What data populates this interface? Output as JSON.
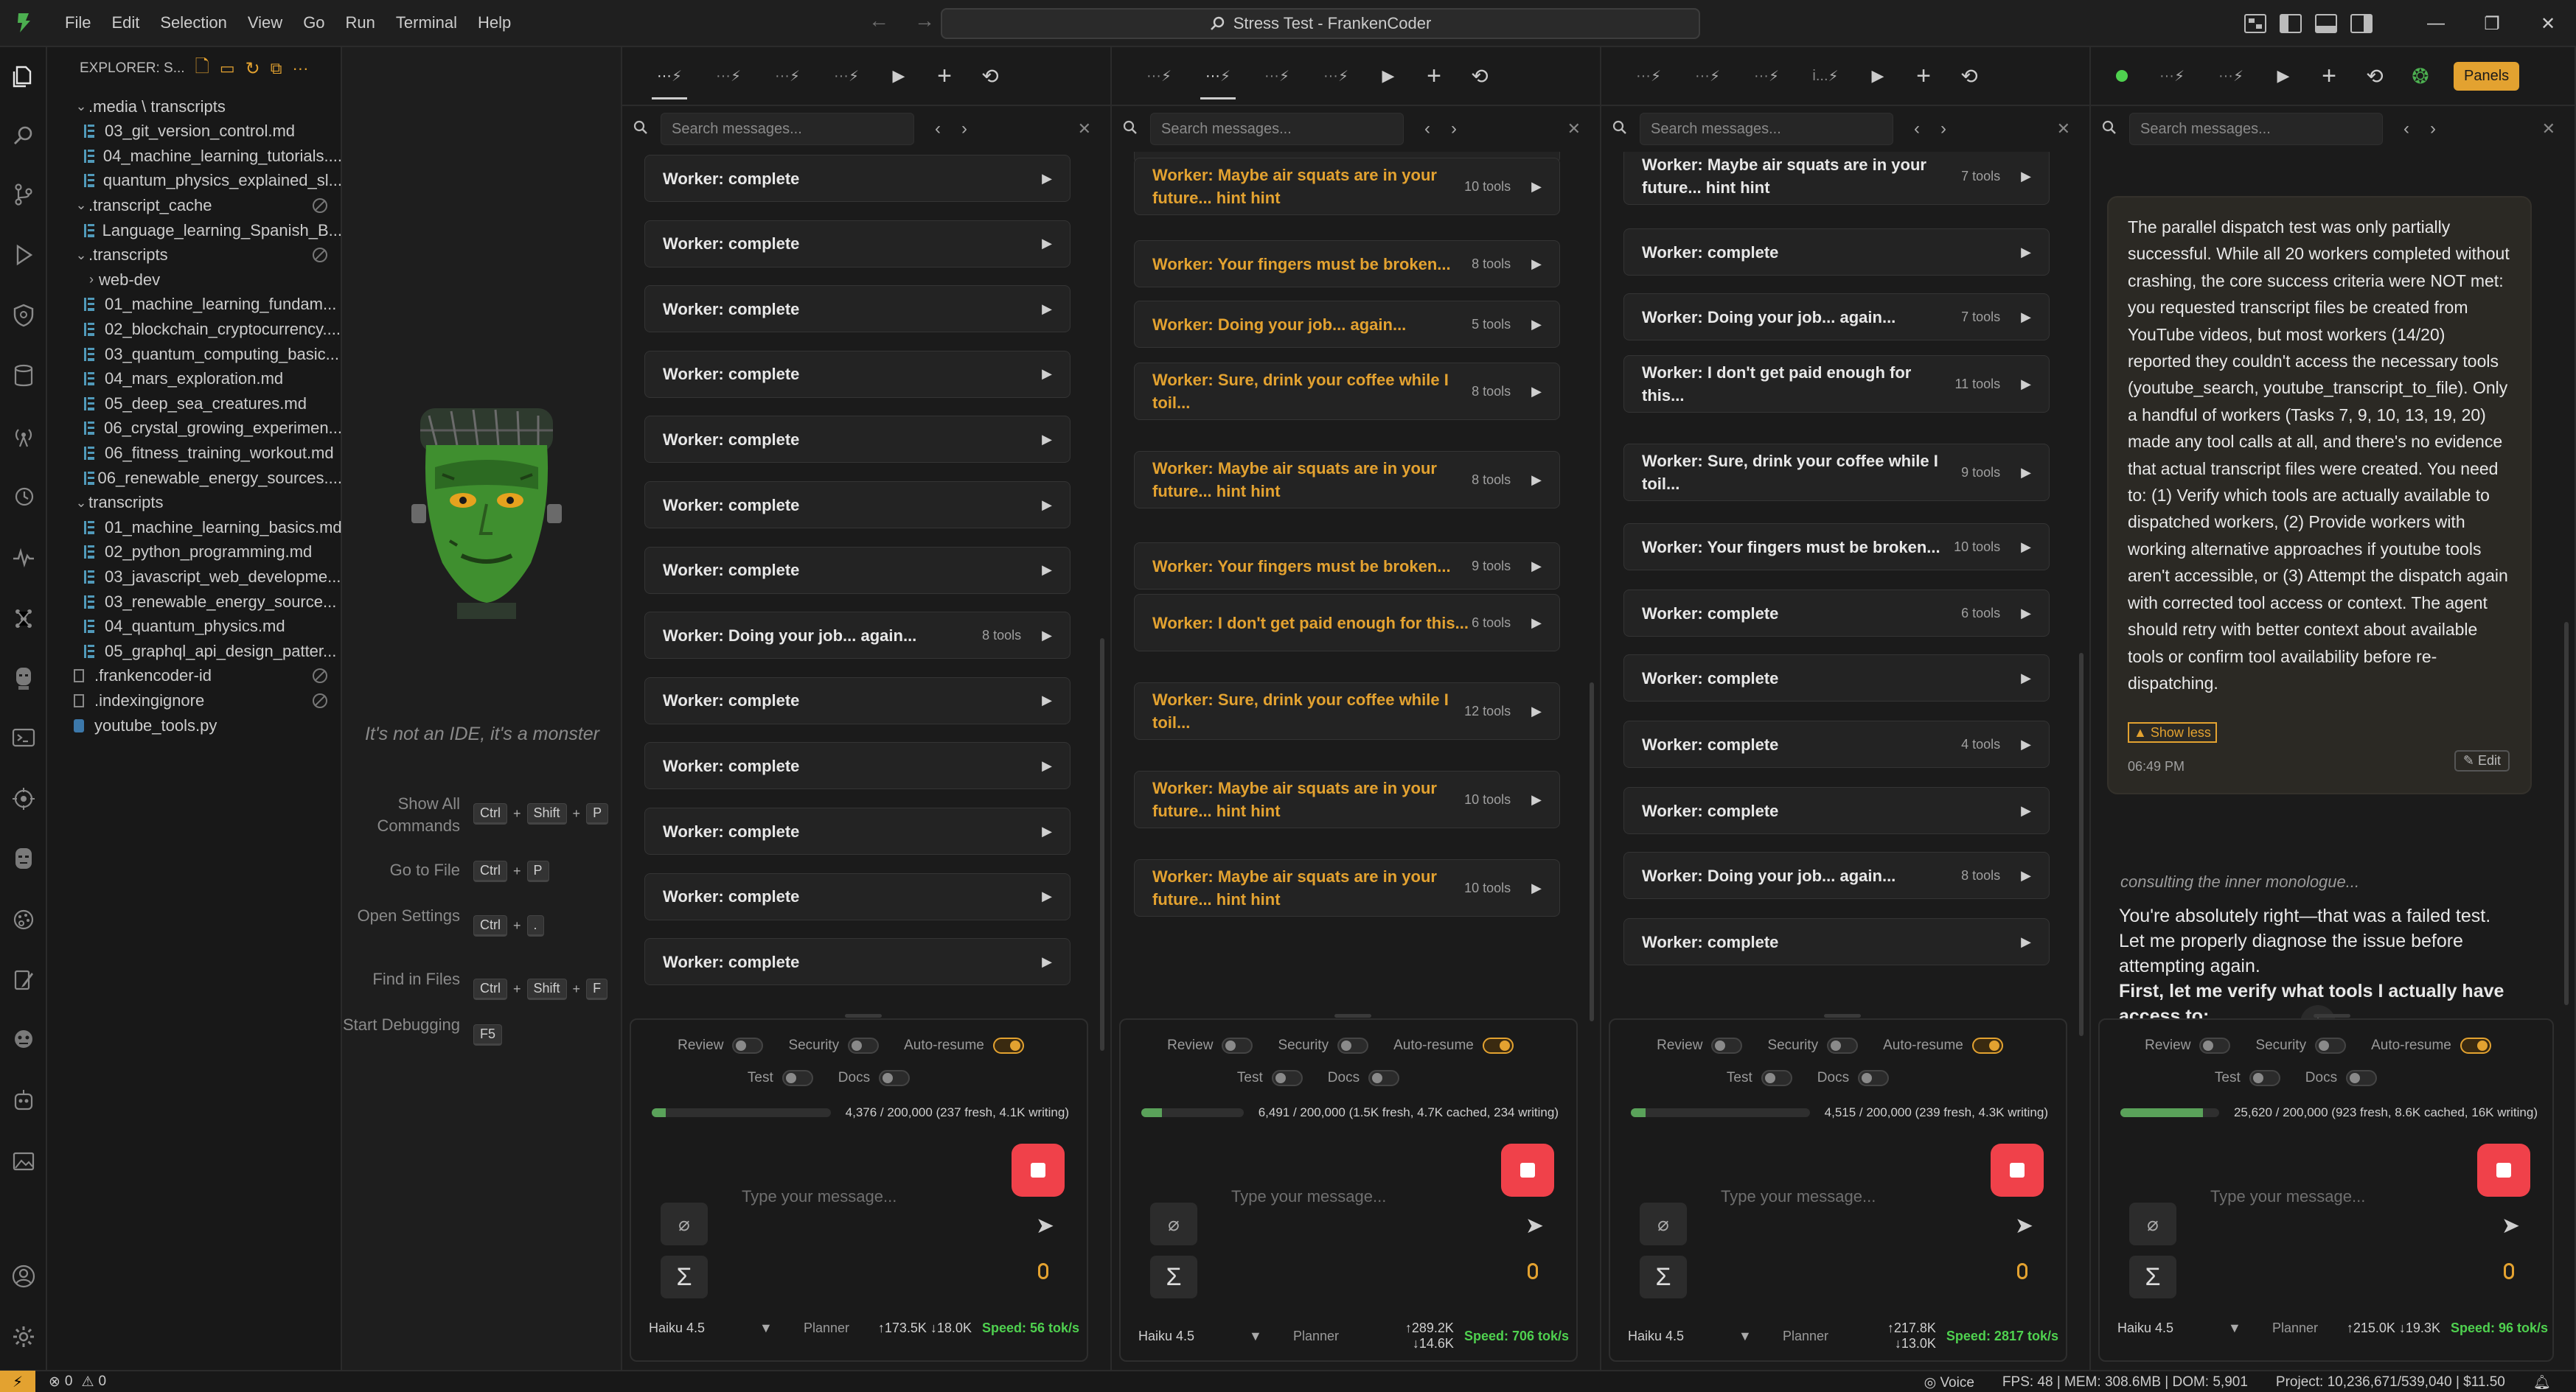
{
  "app": {
    "title": "Stress Test - FrankenCoder"
  },
  "menu": [
    "File",
    "Edit",
    "Selection",
    "View",
    "Go",
    "Run",
    "Terminal",
    "Help"
  ],
  "titlebar": {
    "panels_label": "Panels",
    "nav_back": "←",
    "nav_forward": "→"
  },
  "explorer": {
    "header": "EXPLORER: S...",
    "items": [
      {
        "label": ".media \\ transcripts",
        "type": "folder",
        "open": true,
        "depth": 0
      },
      {
        "label": "03_git_version_control.md",
        "type": "md",
        "depth": 1
      },
      {
        "label": "04_machine_learning_tutorials....",
        "type": "md",
        "depth": 1
      },
      {
        "label": "quantum_physics_explained_sl...",
        "type": "md",
        "depth": 1
      },
      {
        "label": ".transcript_cache",
        "type": "folder",
        "open": true,
        "depth": 0,
        "blocked": true
      },
      {
        "label": "Language_learning_Spanish_B...",
        "type": "md",
        "depth": 1
      },
      {
        "label": ".transcripts",
        "type": "folder",
        "open": true,
        "depth": 0,
        "blocked": true
      },
      {
        "label": "web-dev",
        "type": "folder",
        "open": false,
        "depth": 1
      },
      {
        "label": "01_machine_learning_fundam...",
        "type": "md",
        "depth": 1
      },
      {
        "label": "02_blockchain_cryptocurrency....",
        "type": "md",
        "depth": 1
      },
      {
        "label": "03_quantum_computing_basic...",
        "type": "md",
        "depth": 1
      },
      {
        "label": "04_mars_exploration.md",
        "type": "md",
        "depth": 1
      },
      {
        "label": "05_deep_sea_creatures.md",
        "type": "md",
        "depth": 1
      },
      {
        "label": "06_crystal_growing_experimen...",
        "type": "md",
        "depth": 1
      },
      {
        "label": "06_fitness_training_workout.md",
        "type": "md",
        "depth": 1
      },
      {
        "label": "06_renewable_energy_sources....",
        "type": "md",
        "depth": 1
      },
      {
        "label": "transcripts",
        "type": "folder",
        "open": true,
        "depth": 0
      },
      {
        "label": "01_machine_learning_basics.md",
        "type": "md",
        "depth": 1
      },
      {
        "label": "02_python_programming.md",
        "type": "md",
        "depth": 1
      },
      {
        "label": "03_javascript_web_developme...",
        "type": "md",
        "depth": 1
      },
      {
        "label": "03_renewable_energy_source...",
        "type": "md",
        "depth": 1
      },
      {
        "label": "04_quantum_physics.md",
        "type": "md",
        "depth": 1
      },
      {
        "label": "05_graphql_api_design_patter...",
        "type": "md",
        "depth": 1
      },
      {
        "label": ".frankencoder-id",
        "type": "cfg",
        "depth": 0,
        "blocked": true
      },
      {
        "label": ".indexingignore",
        "type": "cfg",
        "depth": 0,
        "blocked": true
      },
      {
        "label": "youtube_tools.py",
        "type": "py",
        "depth": 0
      }
    ]
  },
  "welcome": {
    "tagline": "It's not an IDE, it's a monster",
    "shortcuts": [
      {
        "label": "Show All Commands",
        "keys": [
          "Ctrl",
          "Shift",
          "P"
        ]
      },
      {
        "label": "Go to File",
        "keys": [
          "Ctrl",
          "P"
        ]
      },
      {
        "label": "Open Settings",
        "keys": [
          "Ctrl",
          "."
        ]
      },
      {
        "label": "Find in Files",
        "keys": [
          "Ctrl",
          "Shift",
          "F"
        ]
      },
      {
        "label": "Start Debugging",
        "keys": [
          "F5"
        ]
      }
    ]
  },
  "common": {
    "search_placeholder": "Search messages...",
    "message_placeholder": "Type your message...",
    "toggles": {
      "review": "Review",
      "security": "Security",
      "auto_resume": "Auto-resume",
      "test": "Test",
      "docs": "Docs"
    },
    "model": "Haiku 4.5",
    "mode": "Planner",
    "edit_label": "Edit",
    "show_less": "▲ Show less"
  },
  "panels": [
    {
      "tabs": [
        "···",
        "···",
        "···",
        "···"
      ],
      "active_tab": 0,
      "workers": [
        {
          "title": "Worker: complete",
          "tools": ""
        },
        {
          "title": "Worker: complete",
          "tools": ""
        },
        {
          "title": "Worker: complete",
          "tools": ""
        },
        {
          "title": "Worker: complete",
          "tools": ""
        },
        {
          "title": "Worker: complete",
          "tools": ""
        },
        {
          "title": "Worker: complete",
          "tools": ""
        },
        {
          "title": "Worker: complete",
          "tools": ""
        },
        {
          "title": "Worker: Doing your job... again...",
          "tools": "8 tools"
        },
        {
          "title": "Worker: complete",
          "tools": ""
        },
        {
          "title": "Worker: complete",
          "tools": ""
        },
        {
          "title": "Worker: complete",
          "tools": ""
        },
        {
          "title": "Worker: complete",
          "tools": ""
        },
        {
          "title": "Worker: complete",
          "tools": ""
        }
      ],
      "progress": {
        "fraction": 0.02188,
        "text": "4,376 / 200,000 (237 fresh, 4.1K writing)"
      },
      "stats": "↑173.5K ↓18.0K",
      "speed": "Speed: 56 tok/s",
      "auto_resume": true
    },
    {
      "tabs": [
        "···",
        "···",
        "···",
        "···"
      ],
      "active_tab": 1,
      "workers": [
        {
          "title": "Worker: Maybe air squats are in your future... hint hint",
          "tools": "10 tools",
          "warn": true
        },
        {
          "title": "Worker: Your fingers must be broken...",
          "tools": "8 tools",
          "warn": true
        },
        {
          "title": "Worker: Doing your job... again...",
          "tools": "5 tools",
          "warn": true
        },
        {
          "title": "Worker: Sure, drink your coffee while I toil...",
          "tools": "8 tools",
          "warn": true
        },
        {
          "title": "Worker: Maybe air squats are in your future... hint hint",
          "tools": "8 tools",
          "warn": true
        },
        {
          "title": "Worker: Your fingers must be broken...",
          "tools": "9 tools",
          "warn": true
        },
        {
          "title": "Worker: I don't get paid enough for this...",
          "tools": "6 tools",
          "warn": true
        },
        {
          "title": "Worker: Sure, drink your coffee while I toil...",
          "tools": "12 tools",
          "warn": true
        },
        {
          "title": "Worker: Maybe air squats are in your future... hint hint",
          "tools": "10 tools",
          "warn": true
        },
        {
          "title": "Worker: Maybe air squats are in your future... hint hint",
          "tools": "10 tools",
          "warn": true
        }
      ],
      "progress": {
        "fraction": 0.03246,
        "text": "6,491 / 200,000 (1.5K fresh, 4.7K cached, 234 writing)"
      },
      "stats": "↑289.2K ↓14.6K",
      "speed": "Speed: 706 tok/s",
      "auto_resume": true
    },
    {
      "tabs": [
        "···",
        "···",
        "···",
        "i..."
      ],
      "active_tab": -1,
      "workers": [
        {
          "title": "Worker: Maybe air squats are in your future... hint hint",
          "tools": "7 tools"
        },
        {
          "title": "Worker: complete",
          "tools": ""
        },
        {
          "title": "Worker: Doing your job... again...",
          "tools": "7 tools"
        },
        {
          "title": "Worker: I don't get paid enough for this...",
          "tools": "11 tools"
        },
        {
          "title": "Worker: Sure, drink your coffee while I toil...",
          "tools": "9 tools"
        },
        {
          "title": "Worker: Your fingers must be broken...",
          "tools": "10 tools"
        },
        {
          "title": "Worker: complete",
          "tools": "6 tools"
        },
        {
          "title": "Worker: complete",
          "tools": ""
        },
        {
          "title": "Worker: complete",
          "tools": "4 tools"
        },
        {
          "title": "Worker: complete",
          "tools": ""
        },
        {
          "title": "Worker: Doing your job... again...",
          "tools": "8 tools"
        },
        {
          "title": "Worker: complete",
          "tools": ""
        }
      ],
      "progress": {
        "fraction": 0.02258,
        "text": "4,515 / 200,000 (239 fresh, 4.3K writing)"
      },
      "stats": "↑217.8K ↓13.0K",
      "speed": "Speed: 2817 tok/s",
      "auto_resume": true
    },
    {
      "tabs": [
        "···",
        "···"
      ],
      "active_tab": -1,
      "chat": {
        "message": "The parallel dispatch test was only partially successful. While all 20 workers completed without crashing, the core success criteria were NOT met: you requested transcript files be created from YouTube videos, but most workers (14/20) reported they couldn't access the necessary tools (youtube_search, youtube_transcript_to_file). Only a handful of workers (Tasks 7, 9, 10, 13, 19, 20) made any tool calls at all, and there's no evidence that actual transcript files were created. You need to: (1) Verify which tools are actually available to dispatched workers, (2) Provide workers with working alternative approaches if youtube tools aren't accessible, or (3) Attempt the dispatch again with corrected tool access or context. The agent should retry with better context about available tools or confirm tool availability before re-dispatching.",
        "time": "06:49 PM",
        "inner": "consulting the inner monologue...",
        "reply": "You're absolutely right—that was a failed test. Let me properly diagnose the issue before attempting again.",
        "reply_bold": "First, let me verify what tools I actually have access to:"
      },
      "progress": {
        "fraction": 0.1281,
        "text": "25,620 / 200,000 (923 fresh, 8.6K cached, 16K writing)"
      },
      "stats": "↑215.0K ↓19.3K",
      "speed": "Speed: 96 tok/s",
      "auto_resume": true
    }
  ],
  "statusbar": {
    "errors": "0",
    "warnings": "0",
    "voice": "Voice",
    "fps": "FPS: 48 | MEM: 308.6MB | DOM: 5,901",
    "project": "Project: 10,236,671/539,040 | $11.50"
  },
  "colors": {
    "accent": "#e3a230",
    "stop": "#f0414a",
    "speed": "#4fd14f",
    "progress": "#5aa25a"
  }
}
